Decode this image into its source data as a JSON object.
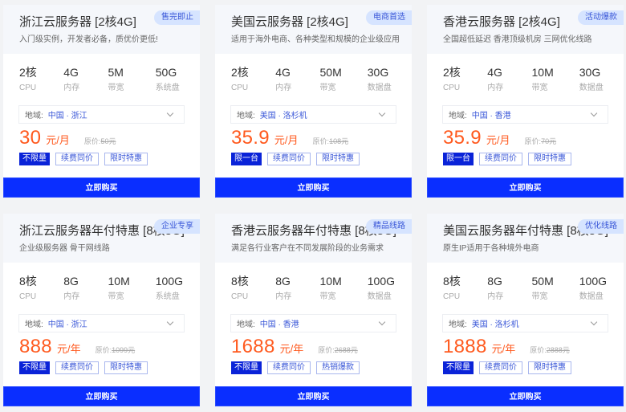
{
  "region_label": "地域:",
  "original_price_label": "原价:",
  "buy_label": "立即购买",
  "colors": {
    "accent_blue": "#0a2eff",
    "price_orange": "#ff5a1f",
    "badge_bg": "#d6e4ff",
    "link_blue": "#3a57d8"
  },
  "cards": [
    {
      "title": "浙江云服务器 [2核4G]",
      "subtitle": "入门级实例，开发者必备，质优价更低!",
      "badge": "售完即止",
      "specs": [
        {
          "value": "2核",
          "label": "CPU"
        },
        {
          "value": "4G",
          "label": "内存"
        },
        {
          "value": "5M",
          "label": "带宽"
        },
        {
          "value": "50G",
          "label": "系统盘"
        }
      ],
      "region": "中国 · 浙江",
      "price": "30",
      "unit": "元/月",
      "original": "50元",
      "tags": [
        "不限量",
        "续费同价",
        "限时特惠"
      ]
    },
    {
      "title": "美国云服务器 [2核4G]",
      "subtitle": "适用于海外电商、各种类型和规模的企业级应用",
      "badge": "电商首选",
      "specs": [
        {
          "value": "2核",
          "label": "CPU"
        },
        {
          "value": "4G",
          "label": "内存"
        },
        {
          "value": "50M",
          "label": "带宽"
        },
        {
          "value": "30G",
          "label": "数据盘"
        }
      ],
      "region": "美国 · 洛杉机",
      "price": "35.9",
      "unit": "元/月",
      "original": "108元",
      "tags": [
        "限一台",
        "续费同价",
        "限时特惠"
      ]
    },
    {
      "title": "香港云服务器 [2核4G]",
      "subtitle": "全国超低延迟 香港顶级机房 三网优化线路",
      "badge": "活动爆款",
      "specs": [
        {
          "value": "2核",
          "label": "CPU"
        },
        {
          "value": "4G",
          "label": "内存"
        },
        {
          "value": "10M",
          "label": "带宽"
        },
        {
          "value": "30G",
          "label": "数据盘"
        }
      ],
      "region": "中国 · 香港",
      "price": "35.9",
      "unit": "元/月",
      "original": "70元",
      "tags": [
        "限一台",
        "续费同价",
        "限时特惠"
      ]
    },
    {
      "title": "浙江云服务器年付特惠 [8核8G]",
      "subtitle": "企业级服务器 骨干网线路",
      "badge": "企业专享",
      "specs": [
        {
          "value": "8核",
          "label": "CPU"
        },
        {
          "value": "8G",
          "label": "内存"
        },
        {
          "value": "10M",
          "label": "带宽"
        },
        {
          "value": "100G",
          "label": "系统盘"
        }
      ],
      "region": "中国 · 浙江",
      "price": "888",
      "unit": "元/年",
      "original": "1099元",
      "tags": [
        "不限量",
        "续费同价",
        "限时特惠"
      ]
    },
    {
      "title": "香港云服务器年付特惠 [8核8G]",
      "subtitle": "满足各行业客户在不同发展阶段的业务需求",
      "badge": "精品线路",
      "specs": [
        {
          "value": "8核",
          "label": "CPU"
        },
        {
          "value": "8G",
          "label": "内存"
        },
        {
          "value": "10M",
          "label": "带宽"
        },
        {
          "value": "100G",
          "label": "数据盘"
        }
      ],
      "region": "中国 · 香港",
      "price": "1688",
      "unit": "元/年",
      "original": "2688元",
      "tags": [
        "不限量",
        "续费同价",
        "热销爆款"
      ]
    },
    {
      "title": "美国云服务器年付特惠 [8核8G]",
      "subtitle": "原生IP适用于各种境外电商",
      "badge": "优化线路",
      "specs": [
        {
          "value": "8核",
          "label": "CPU"
        },
        {
          "value": "8G",
          "label": "内存"
        },
        {
          "value": "50M",
          "label": "带宽"
        },
        {
          "value": "100G",
          "label": "数据盘"
        }
      ],
      "region": "美国 · 洛杉机",
      "price": "1888",
      "unit": "元/年",
      "original": "2888元",
      "tags": [
        "不限量",
        "续费同价",
        "限时特惠"
      ]
    }
  ]
}
